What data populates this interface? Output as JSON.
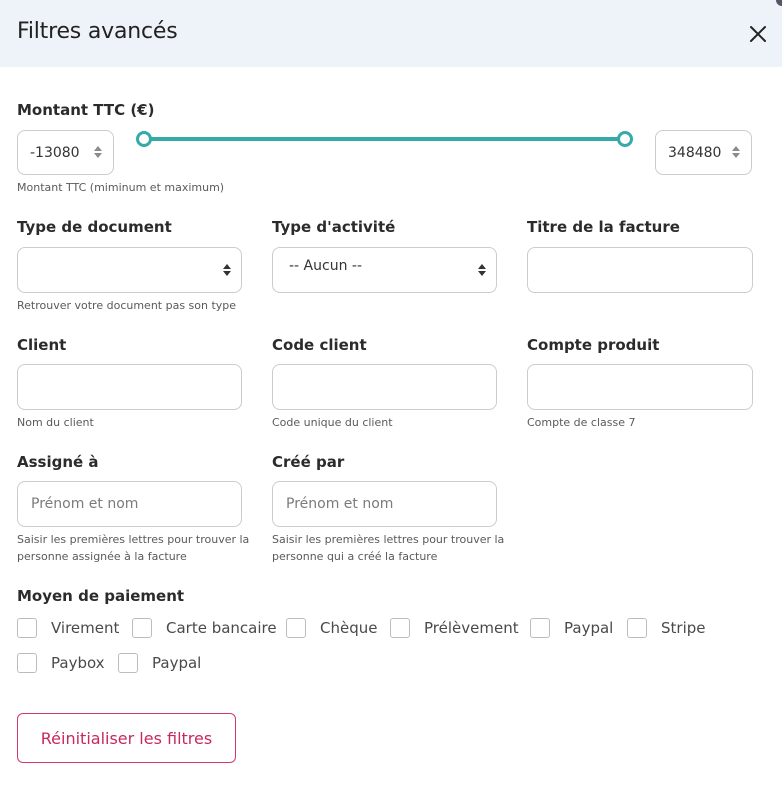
{
  "header": {
    "title": "Filtres avancés",
    "close_icon": "close-icon"
  },
  "amount": {
    "label": "Montant TTC (€)",
    "min_value": "-13080",
    "max_value": "348480",
    "help": "Montant TTC (miminum et maximum)",
    "accent_color": "#35aaa9"
  },
  "doc_type": {
    "label": "Type de document",
    "value": "",
    "help": "Retrouver votre document pas son type"
  },
  "activity_type": {
    "label": "Type d'activité",
    "value": "-- Aucun --"
  },
  "invoice_title": {
    "label": "Titre de la facture",
    "value": ""
  },
  "client": {
    "label": "Client",
    "value": "",
    "help": "Nom du client"
  },
  "client_code": {
    "label": "Code client",
    "value": "",
    "help": "Code unique du client"
  },
  "product_account": {
    "label": "Compte produit",
    "value": "",
    "help": "Compte de classe 7"
  },
  "assigned_to": {
    "label": "Assigné à",
    "placeholder": "Prénom et nom",
    "help_line1": "Saisir les premières lettres pour trouver la",
    "help_line2": "personne assignée à la facture"
  },
  "created_by": {
    "label": "Créé par",
    "placeholder": "Prénom et nom",
    "help_line1": "Saisir les premières lettres pour trouver la",
    "help_line2": "personne qui a créé la facture"
  },
  "payment": {
    "label": "Moyen de paiement",
    "options": [
      "Virement",
      "Carte bancaire",
      "Chèque",
      "Prélèvement",
      "Paypal",
      "Stripe",
      "Paybox",
      "Paypal"
    ]
  },
  "reset_label": "Réinitialiser les filtres",
  "reset_color": "#d2386b"
}
